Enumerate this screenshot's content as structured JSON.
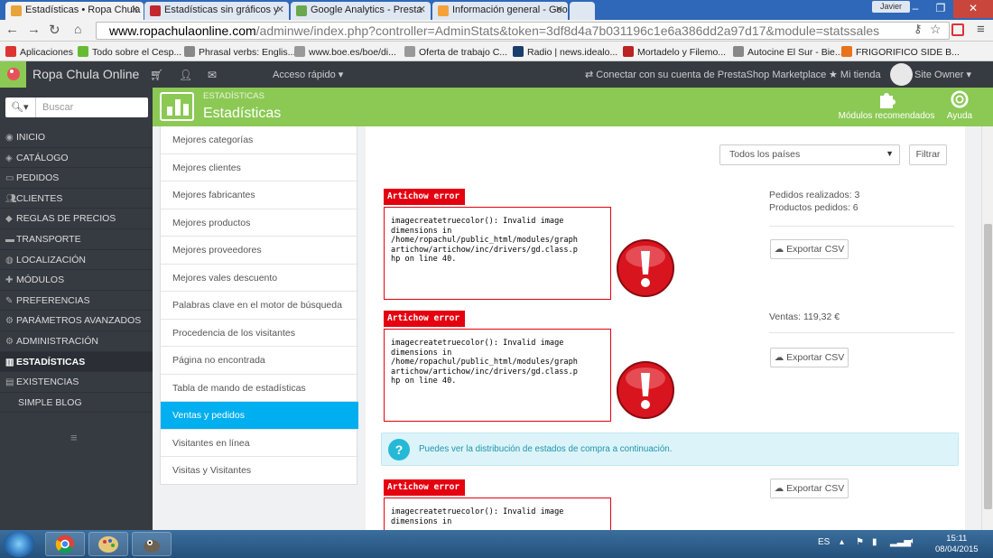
{
  "browser": {
    "tabs": [
      {
        "title": "Estadísticas • Ropa Chula",
        "favicon_color": "#e8a33a"
      },
      {
        "title": "Estadísticas sin gráficos y",
        "favicon_color": "#c1272d"
      },
      {
        "title": "Google Analytics - Presta",
        "favicon_color": "#6aa84f"
      },
      {
        "title": "Información general - Goo",
        "favicon_color": "#f4a13a"
      }
    ],
    "user_chip": "Javier",
    "url": {
      "host": "www.ropachulaonline.com",
      "path": "/adminwe/index.php?controller=AdminStats&token=3df8d4a7b031196c1e6a386dd2a97d17&module=statssales"
    },
    "bookmarks": [
      {
        "label": "Aplicaciones",
        "color": "#d33"
      },
      {
        "label": "Todo sobre el Cesp...",
        "color": "#6b3"
      },
      {
        "label": "Phrasal verbs: Englis...",
        "color": "#888"
      },
      {
        "label": "www.boe.es/boe/di...",
        "color": "#999"
      },
      {
        "label": "Oferta de trabajo C...",
        "color": "#999"
      },
      {
        "label": "Radio | news.idealo...",
        "color": "#1a3e6b"
      },
      {
        "label": "Mortadelo y Filemo...",
        "color": "#b22"
      },
      {
        "label": "Autocine El Sur - Bie...",
        "color": "#888"
      },
      {
        "label": "FRIGORIFICO SIDE B...",
        "color": "#e8731a"
      }
    ]
  },
  "ps_header": {
    "shop_name": "Ropa Chula Online",
    "quick_access": "Acceso rápido",
    "marketplace": "Conectar con su cuenta de PrestaShop Marketplace",
    "my_shop": "Mi tienda",
    "owner": "Site Owner"
  },
  "toolbar": {
    "breadcrumb": "ESTADÍSTICAS",
    "page_title": "Estadísticas",
    "modules_label": "Módulos recomendados",
    "help_label": "Ayuda"
  },
  "sidebar": {
    "search_placeholder": "Buscar",
    "items": [
      {
        "label": "INICIO",
        "icon": "dashboard"
      },
      {
        "label": "CATÁLOGO",
        "icon": "tags"
      },
      {
        "label": "PEDIDOS",
        "icon": "credit-card"
      },
      {
        "label": "CLIENTES",
        "icon": "users"
      },
      {
        "label": "REGLAS DE PRECIOS",
        "icon": "tag"
      },
      {
        "label": "TRANSPORTE",
        "icon": "truck"
      },
      {
        "label": "LOCALIZACIÓN",
        "icon": "globe"
      },
      {
        "label": "MÓDULOS",
        "icon": "puzzle"
      },
      {
        "label": "PREFERENCIAS",
        "icon": "wrench"
      },
      {
        "label": "PARÁMETROS AVANZADOS",
        "icon": "cogs"
      },
      {
        "label": "ADMINISTRACIÓN",
        "icon": "cog"
      },
      {
        "label": "ESTADÍSTICAS",
        "icon": "bar-chart"
      },
      {
        "label": "EXISTENCIAS",
        "icon": "archive"
      },
      {
        "label": "SIMPLE BLOG",
        "icon": ""
      }
    ],
    "active_index": 11
  },
  "stats_list": {
    "items": [
      "Mejores categorías",
      "Mejores clientes",
      "Mejores fabricantes",
      "Mejores productos",
      "Mejores proveedores",
      "Mejores vales descuento",
      "Palabras clave en el motor de búsqueda",
      "Procedencia de los visitantes",
      "Página no encontrada",
      "Tabla de mando de estadísticas",
      "Ventas y pedidos",
      "Visitantes en línea",
      "Visitas y Visitantes"
    ],
    "selected_index": 10
  },
  "main": {
    "country_select": "Todos los países",
    "filter_button": "Filtrar",
    "error_title": "Artichow error",
    "error_message": "imagecreatetruecolor(): Invalid image\ndimensions in\n/home/ropachul/public_html/modules/graph\nartichow/artichow/inc/drivers/gd.class.p\nhp on line 40.",
    "error_message_short": "imagecreatetruecolor(): Invalid image\ndimensions in",
    "orders_placed": "Pedidos realizados: 3",
    "products_ordered": "Productos pedidos: 6",
    "sales": "Ventas: 119,32 €",
    "export_csv": "Exportar CSV",
    "info_text": "Puedes ver la distribución de estados de compra a continuación."
  },
  "taskbar": {
    "lang": "ES",
    "time": "15:11",
    "date": "08/04/2015"
  }
}
